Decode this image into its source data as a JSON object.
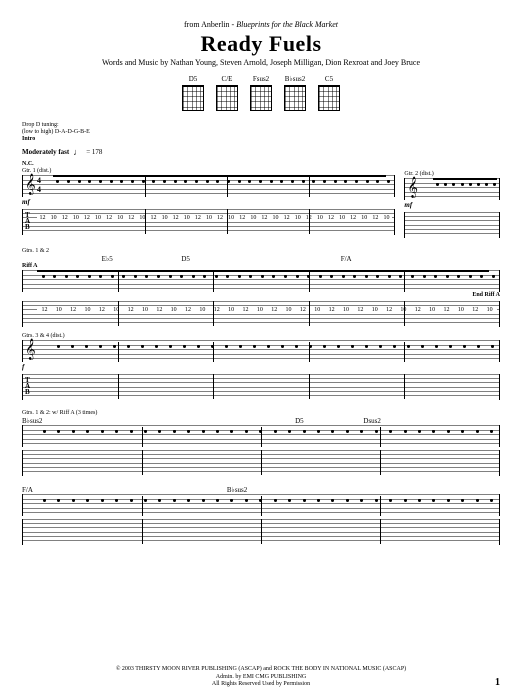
{
  "header": {
    "source_prefix": "from Anberlin - ",
    "album": "Blueprints for the Black Market",
    "title": "Ready Fuels",
    "credits": "Words and Music by Nathan Young, Steven Arnold, Joseph Milligan, Dion Rexroat and Joey Bruce"
  },
  "chords": [
    {
      "name": "D5",
      "fret": ""
    },
    {
      "name": "C/E",
      "fret": ""
    },
    {
      "name": "Fsus2",
      "fret": ""
    },
    {
      "name": "B♭sus2",
      "fret": ""
    },
    {
      "name": "C5",
      "fret": ""
    }
  ],
  "setup": {
    "tuning_label": "Drop D tuning:",
    "tuning": "(low to high) D-A-D-G-B-E",
    "section": "Intro",
    "tempo_label": "Moderately fast",
    "tempo_value": "= 178"
  },
  "system1": {
    "left_part": "Gtr. 1 (dist.)",
    "nc": "N.C.",
    "dynamics": "mf",
    "tab_letters": [
      "T",
      "A",
      "B"
    ],
    "fret_pattern": [
      "12",
      "10",
      "12",
      "10",
      "12",
      "10",
      "12",
      "10",
      "12",
      "10",
      "12",
      "10",
      "12",
      "10",
      "12",
      "10",
      "12",
      "10",
      "12",
      "10",
      "12",
      "10",
      "12",
      "10",
      "12",
      "10",
      "12",
      "10",
      "12",
      "10",
      "12",
      "10"
    ],
    "right_part": "Gtr. 2 (dist.)",
    "right_dyn": "mf"
  },
  "system2": {
    "part": "Gtrs. 1 & 2",
    "chords": [
      "",
      "E♭5",
      "D5",
      "",
      "F/A",
      ""
    ],
    "riff_label_start": "Riff A",
    "riff_label_end": "End Riff A",
    "fret_pattern": [
      "12",
      "10",
      "12",
      "10",
      "12",
      "10",
      "12",
      "10",
      "12",
      "10",
      "12",
      "10",
      "12",
      "10",
      "12",
      "10",
      "12",
      "10",
      "12",
      "10",
      "12",
      "10",
      "12",
      "10",
      "12",
      "10",
      "12",
      "10",
      "12",
      "10",
      "12",
      "10"
    ]
  },
  "system2b": {
    "part": "Gtrs. 3 & 4 (dist.)",
    "dynamics": "f"
  },
  "system3": {
    "part": "Gtrs. 1 & 2: w/ Riff A (3 times)",
    "chords": [
      "B♭sus2",
      "",
      "",
      "",
      "D5",
      "Dsus2",
      ""
    ]
  },
  "system4": {
    "chords": [
      "F/A",
      "",
      "",
      "B♭sus2",
      "",
      "",
      ""
    ]
  },
  "footer": {
    "line1": "© 2003 THIRSTY MOON RIVER PUBLISHING (ASCAP) and ROCK THE BODY IN NATIONAL MUSIC (ASCAP)",
    "line2": "Admin. by EMI CMG PUBLISHING",
    "line3": "All Rights Reserved   Used by Permission"
  },
  "page_number": "1"
}
